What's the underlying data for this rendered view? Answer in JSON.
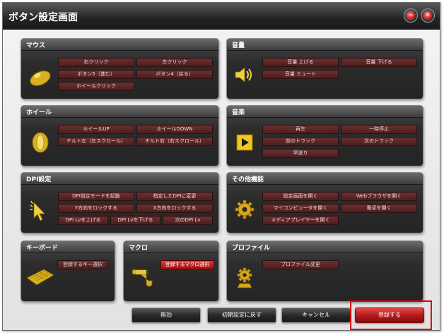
{
  "window": {
    "title": "ボタン設定画面"
  },
  "titlebar": {
    "minimize_glyph": "−",
    "close_glyph": "✕"
  },
  "panels": {
    "mouse": {
      "title": "マウス",
      "buttons": [
        "右クリック",
        "左クリック",
        "ボタン5（進む）",
        "ボタン4（戻る）",
        "ホイールクリック"
      ]
    },
    "volume": {
      "title": "音量",
      "buttons": [
        "音量 上げる",
        "音量 下げる",
        "音量 ミュート"
      ]
    },
    "wheel": {
      "title": "ホイール",
      "buttons": [
        "ホイールUP",
        "ホイールDOWN",
        "チルト左（左スクロール）",
        "チルト右（右スクロール）"
      ]
    },
    "music": {
      "title": "音楽",
      "buttons": [
        "再生",
        "一時停止",
        "前のトラック",
        "次のトラック",
        "早送り"
      ]
    },
    "dpi": {
      "title": "DPI設定",
      "buttons": [
        "DPI設定モードを起動",
        "指定したDPIに変更",
        "Y方向をロックする",
        "X方向をロックする",
        "DPI Lvを上げる",
        "DPI Lvを下げる",
        "次のDPI Lv"
      ]
    },
    "other": {
      "title": "その他機能",
      "buttons": [
        "設定画面を開く",
        "Webブラウザを開く",
        "マイコンピュータを開く",
        "電卓を開く",
        "メディアプレイヤーを開く"
      ]
    },
    "keyboard": {
      "title": "キーボード",
      "buttons": [
        "登録するキー選択"
      ]
    },
    "macro": {
      "title": "マクロ",
      "buttons": [
        "登録するマクロ選択"
      ]
    },
    "profile": {
      "title": "プロファイル",
      "buttons": [
        "プロファイル変更"
      ]
    }
  },
  "footer": {
    "disable": "無効",
    "reset": "初期設定に戻す",
    "cancel": "キャンセル",
    "register": "登録する"
  },
  "colors": {
    "feature_button": "#5a2626",
    "selected_button": "#d42020",
    "panel_bg": "#2a2a2a",
    "highlight_frame": "#e00000"
  }
}
